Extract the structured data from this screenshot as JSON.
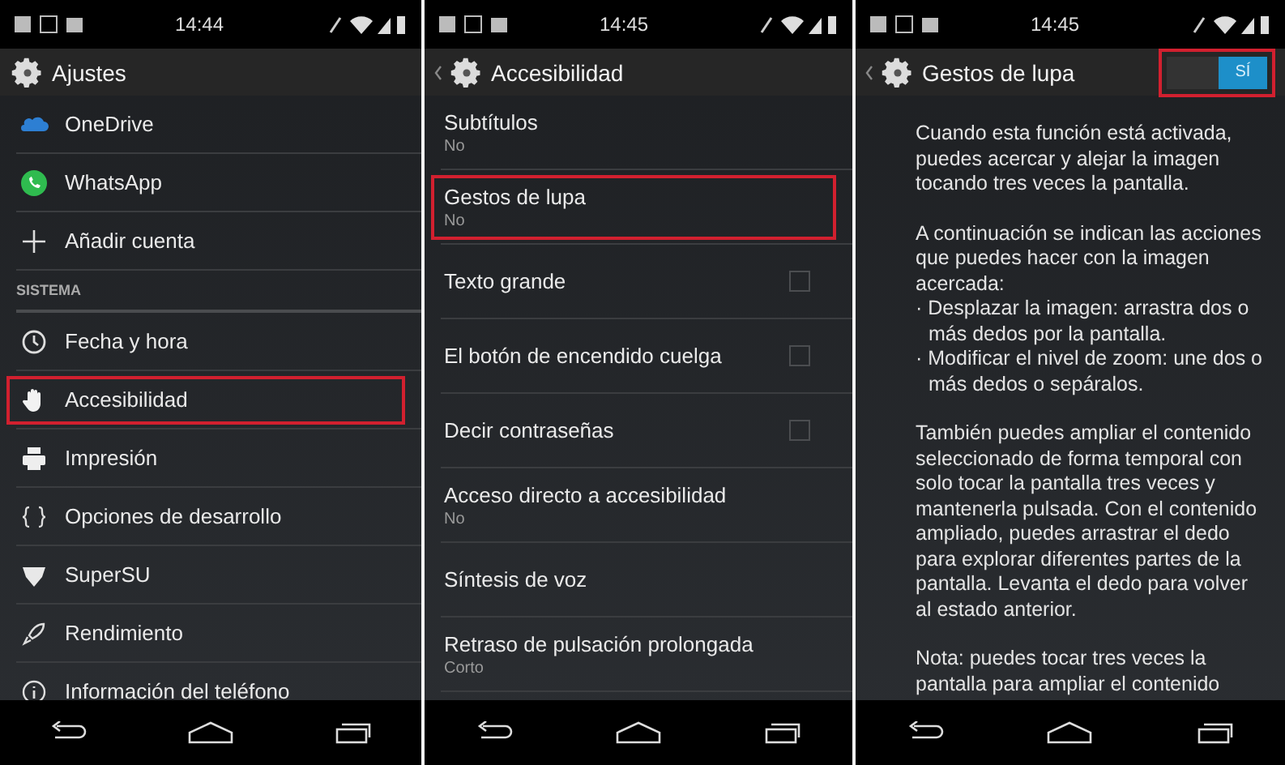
{
  "panels": [
    {
      "kind": "list",
      "status_bar": {
        "time": "14:44"
      },
      "action_bar": {
        "title": "Ajustes",
        "back": false
      },
      "items": [
        {
          "kind": "item",
          "title": "OneDrive",
          "highlighted": false
        },
        {
          "kind": "item",
          "title": "WhatsApp",
          "highlighted": false
        },
        {
          "kind": "item",
          "title": "Añadir cuenta",
          "highlighted": false
        },
        {
          "kind": "header",
          "title": "SISTEMA"
        },
        {
          "kind": "item",
          "title": "Fecha y hora",
          "highlighted": false
        },
        {
          "kind": "item",
          "title": "Accesibilidad",
          "highlighted": true
        },
        {
          "kind": "item",
          "title": "Impresión",
          "highlighted": false
        },
        {
          "kind": "item",
          "title": "Opciones de desarrollo",
          "highlighted": false
        },
        {
          "kind": "item",
          "title": "SuperSU",
          "highlighted": false
        },
        {
          "kind": "item",
          "title": "Rendimiento",
          "highlighted": false
        },
        {
          "kind": "item",
          "title": "Información del teléfono",
          "highlighted": false
        }
      ]
    },
    {
      "kind": "list",
      "status_bar": {
        "time": "14:45"
      },
      "action_bar": {
        "title": "Accesibilidad",
        "back": true
      },
      "items": [
        {
          "kind": "item",
          "title": "Subtítulos",
          "summary": "No",
          "highlighted": false
        },
        {
          "kind": "item",
          "title": "Gestos de lupa",
          "summary": "No",
          "highlighted": true
        },
        {
          "kind": "check",
          "title": "Texto grande",
          "checked": false,
          "highlighted": false
        },
        {
          "kind": "check",
          "title": "El botón de encendido cuelga",
          "checked": false,
          "highlighted": false
        },
        {
          "kind": "check",
          "title": "Decir contraseñas",
          "checked": false,
          "highlighted": false
        },
        {
          "kind": "item",
          "title": "Acceso directo a accesibilidad",
          "summary": "No",
          "highlighted": false
        },
        {
          "kind": "item",
          "title": "Síntesis de voz",
          "highlighted": false
        },
        {
          "kind": "item",
          "title": "Retraso de pulsación prolongada",
          "summary": "Corto",
          "highlighted": false
        }
      ]
    },
    {
      "kind": "text",
      "status_bar": {
        "time": "14:45"
      },
      "action_bar": {
        "title": "Gestos de lupa",
        "back": true,
        "switch": {
          "label": "SÍ",
          "on": true,
          "highlighted": true
        }
      },
      "paragraphs": [
        [
          "Cuando esta función está activada, puedes acercar y alejar la imagen tocando tres veces la pantalla."
        ],
        [
          "A continuación se indican las acciones que puedes hacer con la imagen acercada:",
          "· Desplazar la imagen: arrastra dos o más dedos por la pantalla.",
          "· Modificar el nivel de zoom: une dos o más dedos o sepáralos."
        ],
        [
          "También puedes ampliar el contenido seleccionado de forma temporal con solo tocar la pantalla tres veces y mantenerla pulsada. Con el contenido ampliado, puedes arrastrar el dedo para explorar diferentes partes de la pantalla. Levanta el dedo para volver al estado anterior."
        ],
        [
          "Nota: puedes tocar tres veces la pantalla para ampliar el contenido"
        ]
      ]
    }
  ]
}
